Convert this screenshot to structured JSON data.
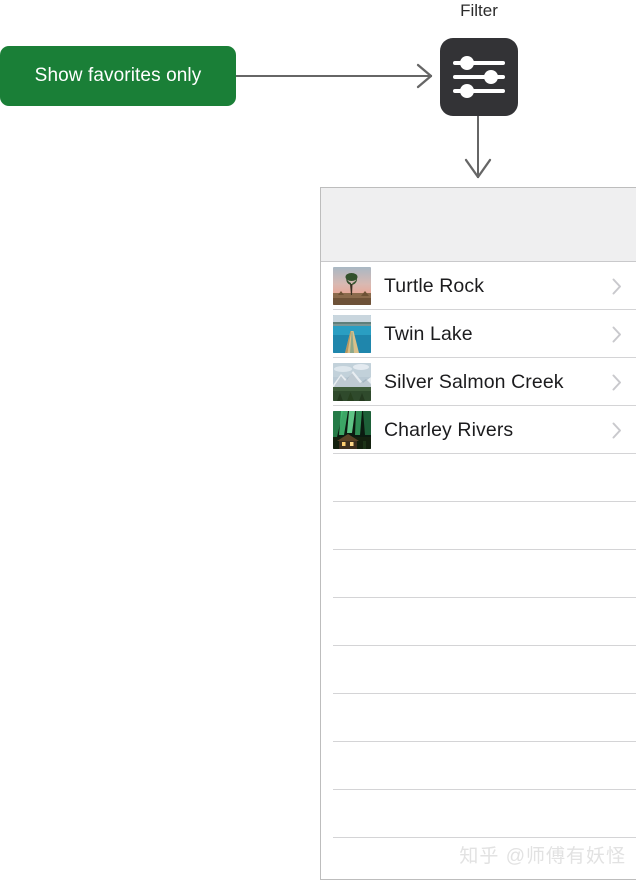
{
  "callout": {
    "label": "Show favorites only",
    "color": "#1a7f37",
    "text_color": "#ffffff"
  },
  "filter": {
    "label": "Filter",
    "icon": "sliders-filter-icon",
    "icon_bg": "#333336",
    "icon_fg": "#ffffff"
  },
  "arrows": {
    "horizontal": "arrow-right",
    "vertical": "arrow-down",
    "color": "#666666"
  },
  "panel": {
    "border_color": "#bdbdbd",
    "header_bg": "#efeff0",
    "separator_color": "#d4d4d6",
    "chevron_color": "#c9c9cd",
    "rows": [
      {
        "title": "Turtle Rock",
        "thumbnail": "joshua-tree-sunset-thumbnail",
        "chevron": "chevron-right-icon"
      },
      {
        "title": "Twin Lake",
        "thumbnail": "canoe-lake-thumbnail",
        "chevron": "chevron-right-icon"
      },
      {
        "title": "Silver Salmon Creek",
        "thumbnail": "snowy-mountain-thumbnail",
        "chevron": "chevron-right-icon"
      },
      {
        "title": "Charley Rivers",
        "thumbnail": "aurora-cabin-thumbnail",
        "chevron": "chevron-right-icon"
      }
    ],
    "empty_row_count": 8
  },
  "watermark": {
    "text": "知乎 @师傅有妖怪"
  }
}
